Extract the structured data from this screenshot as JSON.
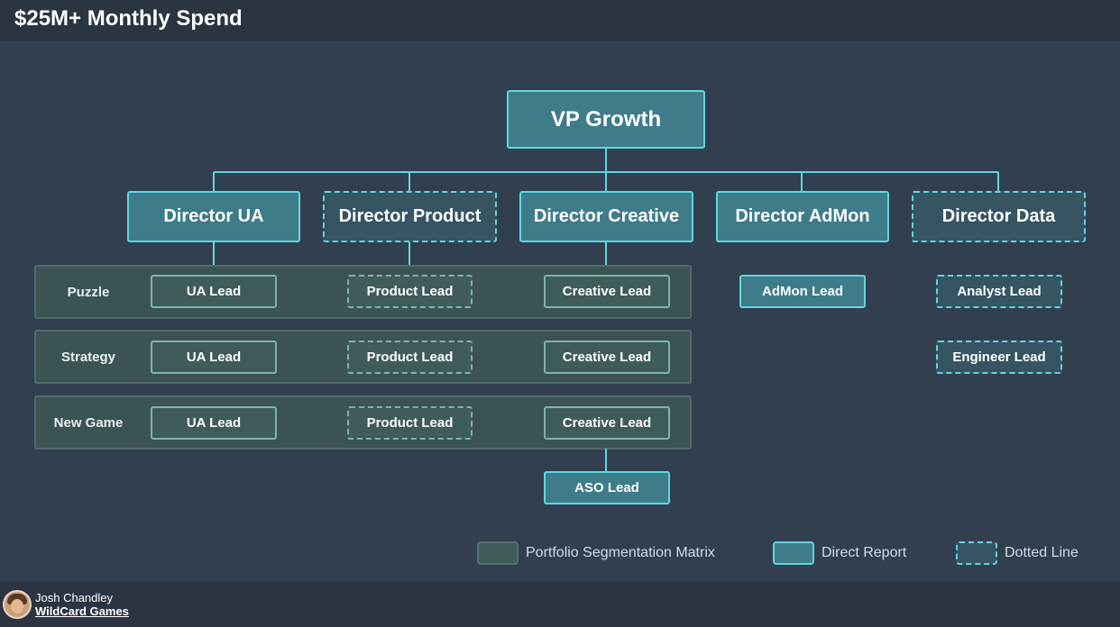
{
  "title": "$25M+ Monthly Spend",
  "vp": {
    "label": "VP Growth"
  },
  "directors": [
    {
      "label": "Director UA",
      "style": "solid"
    },
    {
      "label": "Director Product",
      "style": "dotted"
    },
    {
      "label": "Director Creative",
      "style": "solid"
    },
    {
      "label": "Director AdMon",
      "style": "solid"
    },
    {
      "label": "Director Data",
      "style": "dotted"
    }
  ],
  "matrix": {
    "rows": [
      {
        "segment": "Puzzle",
        "leads": [
          "UA Lead",
          "Product Lead",
          "Creative Lead"
        ]
      },
      {
        "segment": "Strategy",
        "leads": [
          "UA Lead",
          "Product Lead",
          "Creative Lead"
        ]
      },
      {
        "segment": "New Game",
        "leads": [
          "UA Lead",
          "Product Lead",
          "Creative Lead"
        ]
      }
    ]
  },
  "aso_lead": "ASO Lead",
  "admon_lead": "AdMon Lead",
  "data_leads": [
    "Analyst Lead",
    "Engineer Lead"
  ],
  "legend": {
    "matrix": "Portfolio Segmentation Matrix",
    "direct": "Direct Report",
    "dotted": "Dotted Line"
  },
  "footer": {
    "presenter": "Josh Chandley",
    "company": "WildCard Games"
  },
  "colors": {
    "header_bg": "#2b3542",
    "canvas_bg": "#323f4f",
    "accent": "#5fd6e3",
    "solid_fill": "#3e7c8a",
    "matrix_fill": "#3f5b5a"
  },
  "icons": {
    "avatar": "presenter-photo"
  }
}
